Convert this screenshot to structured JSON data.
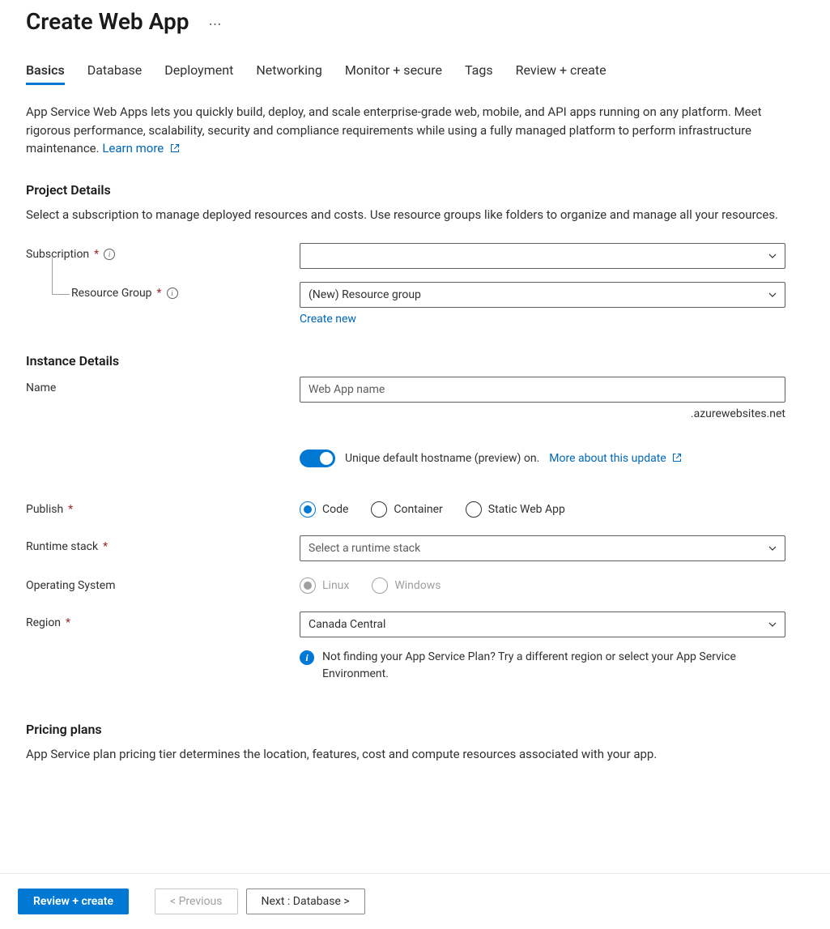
{
  "header": {
    "title": "Create Web App"
  },
  "tabs": [
    {
      "label": "Basics",
      "active": true
    },
    {
      "label": "Database",
      "active": false
    },
    {
      "label": "Deployment",
      "active": false
    },
    {
      "label": "Networking",
      "active": false
    },
    {
      "label": "Monitor + secure",
      "active": false
    },
    {
      "label": "Tags",
      "active": false
    },
    {
      "label": "Review + create",
      "active": false
    }
  ],
  "intro": {
    "text": "App Service Web Apps lets you quickly build, deploy, and scale enterprise-grade web, mobile, and API apps running on any platform. Meet rigorous performance, scalability, security and compliance requirements while using a fully managed platform to perform infrastructure maintenance.  ",
    "learn_more": "Learn more"
  },
  "sections": {
    "project": {
      "title": "Project Details",
      "desc": "Select a subscription to manage deployed resources and costs. Use resource groups like folders to organize and manage all your resources.",
      "subscription_label": "Subscription",
      "subscription_value": "",
      "resource_group_label": "Resource Group",
      "resource_group_value": "(New) Resource group",
      "create_new": "Create new"
    },
    "instance": {
      "title": "Instance Details",
      "name_label": "Name",
      "name_placeholder": "Web App name",
      "name_suffix": ".azurewebsites.net",
      "hostname_toggle_label": "Unique default hostname (preview) on.",
      "hostname_more": "More about this update",
      "publish_label": "Publish",
      "publish_options": {
        "code": "Code",
        "container": "Container",
        "static": "Static Web App"
      },
      "runtime_label": "Runtime stack",
      "runtime_placeholder": "Select a runtime stack",
      "os_label": "Operating System",
      "os_options": {
        "linux": "Linux",
        "windows": "Windows"
      },
      "region_label": "Region",
      "region_value": "Canada Central",
      "region_info": "Not finding your App Service Plan? Try a different region or select your App Service Environment."
    },
    "pricing": {
      "title": "Pricing plans",
      "desc": "App Service plan pricing tier determines the location, features, cost and compute resources associated with your app."
    }
  },
  "footer": {
    "review": "Review + create",
    "previous": "< Previous",
    "next": "Next : Database >"
  }
}
